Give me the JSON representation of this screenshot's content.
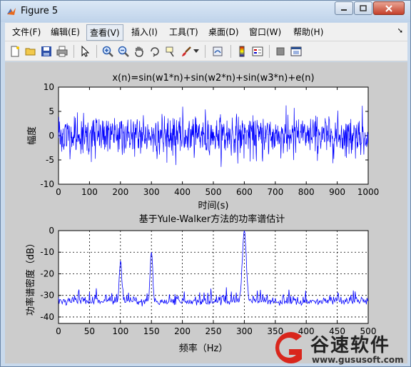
{
  "window": {
    "title": "Figure 5"
  },
  "menu": {
    "items": [
      "文件(F)",
      "编辑(E)",
      "查看(V)",
      "插入(I)",
      "工具(T)",
      "桌面(D)",
      "窗口(W)",
      "帮助(H)"
    ],
    "active": "查看(V)"
  },
  "toolbar": {
    "icons": [
      "new-figure-icon",
      "open-file-icon",
      "save-icon",
      "print-icon",
      "select-arrow-icon",
      "zoom-in-icon",
      "zoom-out-icon",
      "pan-hand-icon",
      "rotate-3d-icon",
      "data-cursor-icon",
      "brush-icon",
      "brush-dropdown-icon",
      "link-plot-icon",
      "colorbar-icon",
      "legend-icon",
      "hide-plot-tools-icon",
      "show-plot-tools-icon"
    ]
  },
  "chart_data": [
    {
      "type": "line",
      "title": "x(n)=sin(w1*n)+sin(w2*n)+sin(w3*n)+e(n)",
      "xlabel": "时间(s)",
      "ylabel": "幅度",
      "xlim": [
        0,
        1000
      ],
      "ylim": [
        -10,
        10
      ],
      "xticks": [
        0,
        100,
        200,
        300,
        400,
        500,
        600,
        700,
        800,
        900,
        1000
      ],
      "yticks": [
        -10,
        -5,
        0,
        5,
        10
      ],
      "grid": false,
      "color": "#0000ff",
      "series": [
        {
          "description_of_signal": "noisy sum of three sinusoids, values mostly between -5 and 5",
          "x_start": 0,
          "x_end": 1000,
          "amplitude_typical": 3.5,
          "amplitude_peak": 6.5
        }
      ]
    },
    {
      "type": "line",
      "title": "基于Yule-Walker方法的功率谱估计",
      "xlabel": "频率（Hz）",
      "ylabel": "功率谱密度（dB）",
      "xlim": [
        0,
        500
      ],
      "ylim": [
        -43,
        0
      ],
      "xticks": [
        0,
        50,
        100,
        150,
        200,
        250,
        300,
        350,
        400,
        450,
        500
      ],
      "yticks": [
        -40,
        -30,
        -20,
        -10,
        0
      ],
      "grid": true,
      "color": "#0000ff",
      "peaks": [
        {
          "x": 100,
          "y": -14
        },
        {
          "x": 150,
          "y": -10
        },
        {
          "x": 300,
          "y": 0
        }
      ],
      "noise_floor": -34
    }
  ],
  "watermark": {
    "title": "谷速软件",
    "url": "www.gususoft.com"
  }
}
